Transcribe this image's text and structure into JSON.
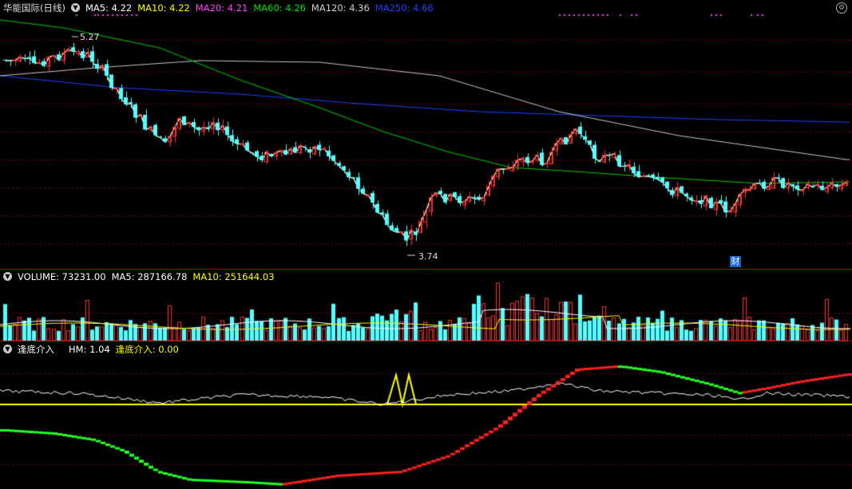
{
  "main_header": {
    "title": "华能国际(日线)",
    "items": [
      {
        "label": "MA5: 4.22",
        "color": "#ffffff"
      },
      {
        "label": "MA10: 4.22",
        "color": "#ffff00"
      },
      {
        "label": "MA20: 4.21",
        "color": "#ff40ff"
      },
      {
        "label": "MA60: 4.26",
        "color": "#00e000"
      },
      {
        "label": "MA120: 4.36",
        "color": "#d0d0d0"
      },
      {
        "label": "MA250: 4.66",
        "color": "#2040ff"
      }
    ]
  },
  "price_annotations": {
    "high_label": "5.27",
    "low_label": "3.74"
  },
  "event_marker": {
    "label": "财"
  },
  "volume_header": {
    "items": [
      {
        "label": "VOLUME: 73231.00",
        "color": "#ffffff"
      },
      {
        "label": "MA5: 287166.78",
        "color": "#ffffff"
      },
      {
        "label": "MA10: 251644.03",
        "color": "#ffff00"
      }
    ]
  },
  "indicator_header": {
    "items": [
      {
        "label": "逢底介入",
        "color": "#ffffff"
      },
      {
        "label": "HM: 1.04",
        "color": "#ffffff"
      },
      {
        "label": "逢底介入: 0.00",
        "color": "#ffff00"
      }
    ]
  },
  "colors": {
    "up": "#ff3232",
    "down": "#54ffff",
    "grid": "#7a0000"
  },
  "chart_data": {
    "type": "candlestick",
    "price_range": [
      3.6,
      5.5
    ],
    "candles": [],
    "moving_averages": [
      "MA5",
      "MA10",
      "MA20",
      "MA60",
      "MA120",
      "MA250"
    ]
  }
}
